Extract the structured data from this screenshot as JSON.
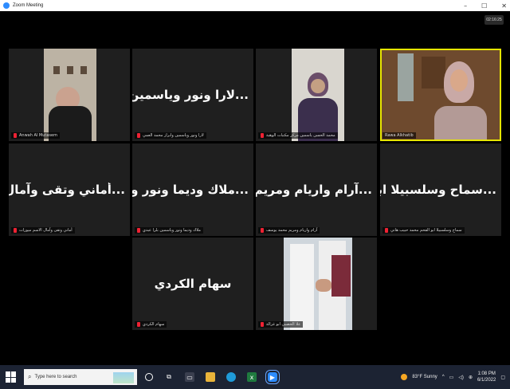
{
  "window": {
    "title": "Zoom Meeting",
    "timer": "02:16:25"
  },
  "tiles": [
    {
      "name": "Anwah Al Mutasem"
    },
    {
      "name": "لارا ونور وياسمين وابراز محمد العمي",
      "big": "...لارا ونور وياسمين"
    },
    {
      "name": "محمد الحسن ياسمين مركز مكتبات الوهبة"
    },
    {
      "name": "Rawa Alkhatib"
    },
    {
      "name": "أماني وتقى وآمال الاسم ميورات",
      "big": "...أماني وتقى وآمال"
    },
    {
      "name": "ملاك وديما ونور وياسمين بلرا عبدي",
      "big": "...ملاك وديما ونور وا"
    },
    {
      "name": "آرام واريام ومريم محمد يوسف",
      "big": "...آرام واريام ومريم"
    },
    {
      "name": "سماح وسلسبيلا ابو الفحم محمد حبيب هاني",
      "big": "...سماح وسلسبيلا ابـ"
    },
    {
      "name": "سهام الكردي",
      "big": "سهام الكردي"
    },
    {
      "name": "علا الحصبي ابو غزالة"
    }
  ],
  "taskbar": {
    "search_placeholder": "Type here to search",
    "weather": "83°F Sunny",
    "time": "1:08 PM",
    "date": "6/1/2022"
  }
}
